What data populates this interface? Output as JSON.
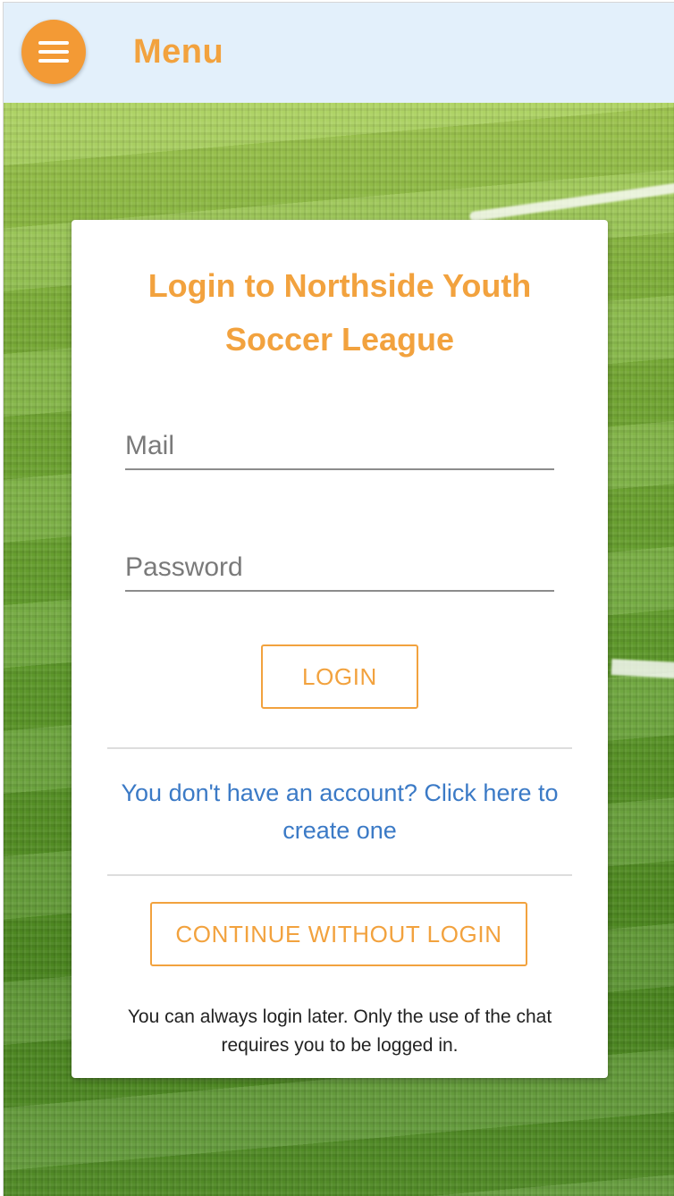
{
  "header": {
    "menu_title": "Menu",
    "menu_button_icon": "hamburger-menu-icon",
    "background_color": "#e3f0fb",
    "accent_color": "#f39a35"
  },
  "login_card": {
    "title": "Login to Northside Youth Soccer League",
    "mail_field": {
      "placeholder": "Mail",
      "value": ""
    },
    "password_field": {
      "placeholder": "Password",
      "value": ""
    },
    "login_button_label": "LOGIN",
    "signup_link_text": "You don't have an account? Click here to create one",
    "continue_button_label": "CONTINUE WITHOUT LOGIN",
    "note_text": "You can always login later. Only the use of the chat requires you to be logged in."
  },
  "colors": {
    "title_orange": "#f2a23e",
    "link_blue": "#3b7ac6",
    "grass_green": "#5f9a29"
  }
}
